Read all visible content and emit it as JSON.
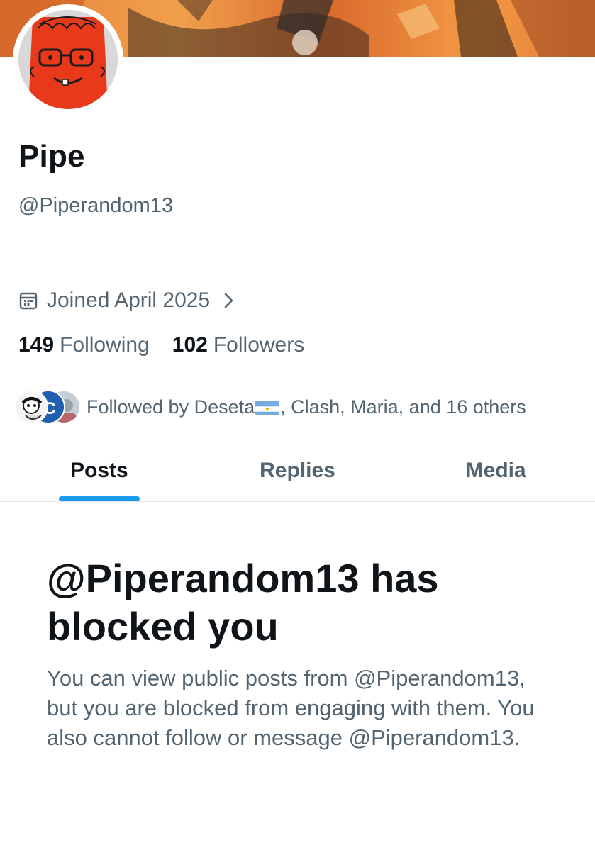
{
  "profile": {
    "display_name": "Pipe",
    "handle": "@Piperandom13",
    "joined": "Joined April 2025",
    "following_count": "149",
    "following_label": "Following",
    "followers_count": "102",
    "followers_label": "Followers"
  },
  "followed_by": {
    "prefix": "Followed by Deseta",
    "suffix": ", Clash, Maria, and 16 others"
  },
  "tabs": [
    {
      "label": "Posts",
      "active": true
    },
    {
      "label": "Replies",
      "active": false
    },
    {
      "label": "Media",
      "active": false
    }
  ],
  "blocked": {
    "title": "@Piperandom13 has blocked you",
    "body": "You can view public posts from @Piperandom13, but you are blocked from engaging with them. You also cannot follow or message @Piperandom13."
  },
  "colors": {
    "accent": "#1d9bf0",
    "secondary_text": "#536471",
    "primary_text": "#0f1419"
  },
  "icons": {
    "calendar": "calendar-icon",
    "chevron": "chevron-right-icon"
  }
}
